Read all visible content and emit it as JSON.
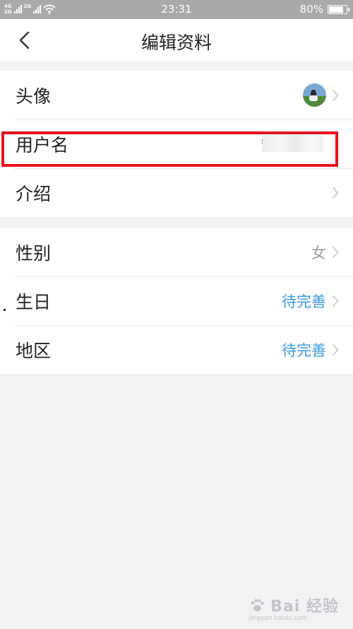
{
  "status_bar": {
    "network_top": "4G",
    "network_bottom": "2G",
    "network_top_2": "2G",
    "time": "23:31",
    "battery": "80%"
  },
  "header": {
    "title": "编辑资料",
    "back_icon": "chevron-left-icon"
  },
  "profile": {
    "rows": [
      {
        "label": "头像",
        "kind": "avatar"
      },
      {
        "label": "用户名",
        "value": "安"
      },
      {
        "label": "介绍",
        "value": ""
      }
    ],
    "details": [
      {
        "label": "性别",
        "value": "女"
      },
      {
        "label": "生日",
        "value": "待完善"
      },
      {
        "label": "地区",
        "value": "待完善"
      }
    ]
  },
  "colors": {
    "accent_link": "#3b9ad9",
    "highlight": "#e8141b",
    "status_bar": "#a9a9a9",
    "background": "#f2f2f4"
  },
  "watermark": {
    "brand": "Bai 经验",
    "url": "jingyan.baidu.com"
  }
}
